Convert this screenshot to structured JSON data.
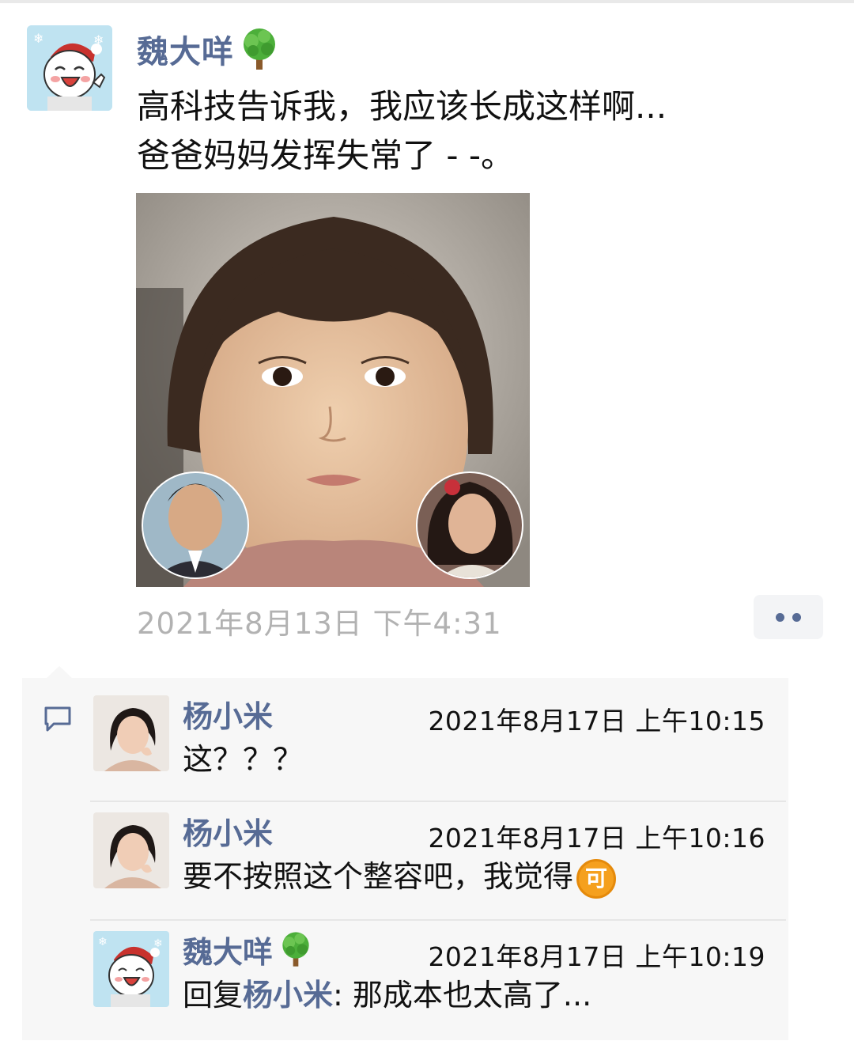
{
  "post": {
    "author": "魏大咩",
    "text_line1": "高科技告诉我，我应该长成这样啊...",
    "text_line2": "爸爸妈妈发挥失常了 - -。",
    "timestamp": "2021年8月13日 下午4:31"
  },
  "comments": [
    {
      "author": "杨小米",
      "time": "2021年8月17日 上午10:15",
      "text": "这？？？"
    },
    {
      "author": "杨小米",
      "time": "2021年8月17日 上午10:16",
      "text": "要不按照这个整容吧，我觉得",
      "emoji": "可"
    },
    {
      "author": "魏大咩",
      "time": "2021年8月17日 上午10:19",
      "reply_prefix": "回复",
      "reply_to": "杨小米",
      "text": ": 那成本也太高了..."
    }
  ],
  "colors": {
    "link": "#576b95",
    "timestamp_gray": "#b2b2b2",
    "comment_bg": "#f7f7f7",
    "emoji_orange": "#f5a01e"
  },
  "icons": [
    "tree-emoji-icon",
    "comment-bubble-icon",
    "more-dots-icon",
    "ke-emoji-icon"
  ]
}
